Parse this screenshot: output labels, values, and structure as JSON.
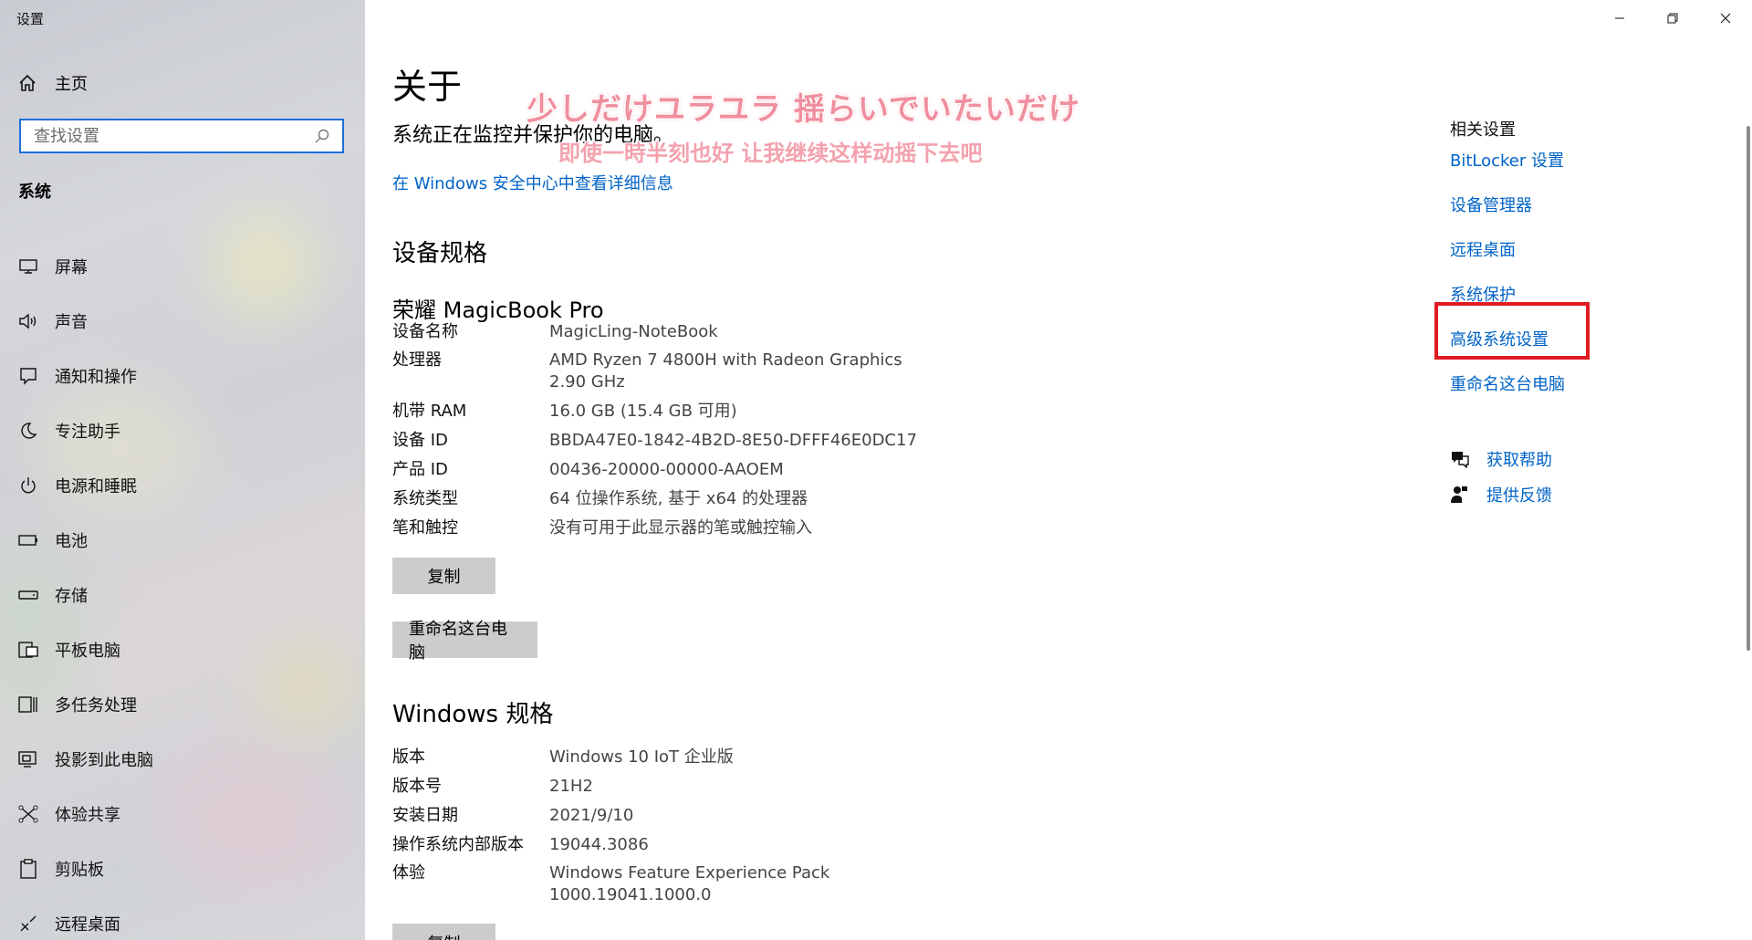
{
  "window": {
    "title": "设置",
    "controls": [
      "minimize-icon",
      "restore-icon",
      "close-icon"
    ]
  },
  "sidebar": {
    "home_label": "主页",
    "search_placeholder": "查找设置",
    "section_title": "系统",
    "items": [
      {
        "label": "屏幕",
        "icon": "monitor-icon"
      },
      {
        "label": "声音",
        "icon": "speaker-icon"
      },
      {
        "label": "通知和操作",
        "icon": "notification-icon"
      },
      {
        "label": "专注助手",
        "icon": "moon-icon"
      },
      {
        "label": "电源和睡眠",
        "icon": "power-icon"
      },
      {
        "label": "电池",
        "icon": "battery-icon"
      },
      {
        "label": "存储",
        "icon": "storage-icon"
      },
      {
        "label": "平板电脑",
        "icon": "tablet-icon"
      },
      {
        "label": "多任务处理",
        "icon": "multitask-icon"
      },
      {
        "label": "投影到此电脑",
        "icon": "project-icon"
      },
      {
        "label": "体验共享",
        "icon": "share-icon"
      },
      {
        "label": "剪贴板",
        "icon": "clipboard-icon"
      },
      {
        "label": "远程桌面",
        "icon": "remote-desktop-icon"
      }
    ]
  },
  "main": {
    "title": "关于",
    "protect_text": "系统正在监控并保护你的电脑。",
    "security_link": "在 Windows 安全中心中查看详细信息",
    "device_spec_title": "设备规格",
    "device_model": "荣耀 MagicBook Pro",
    "device_specs": [
      {
        "key": "设备名称",
        "value": "MagicLing-NoteBook"
      },
      {
        "key": "处理器",
        "value": "AMD Ryzen 7 4800H with Radeon Graphics",
        "value2": "2.90 GHz"
      },
      {
        "key": "机带 RAM",
        "value": "16.0 GB (15.4 GB 可用)"
      },
      {
        "key": "设备 ID",
        "value": "BBDA47E0-1842-4B2D-8E50-DFFF46E0DC17"
      },
      {
        "key": "产品 ID",
        "value": "00436-20000-00000-AAOEM"
      },
      {
        "key": "系统类型",
        "value": "64 位操作系统, 基于 x64 的处理器"
      },
      {
        "key": "笔和触控",
        "value": "没有可用于此显示器的笔或触控输入"
      }
    ],
    "copy_button": "复制",
    "rename_button": "重命名这台电脑",
    "windows_spec_title": "Windows 规格",
    "windows_specs": [
      {
        "key": "版本",
        "value": "Windows 10 IoT 企业版"
      },
      {
        "key": "版本号",
        "value": "21H2"
      },
      {
        "key": "安装日期",
        "value": "2021/9/10"
      },
      {
        "key": "操作系统内部版本",
        "value": "19044.3086"
      },
      {
        "key": "体验",
        "value": "Windows Feature Experience Pack",
        "value2": "1000.19041.1000.0"
      }
    ],
    "copy_button_2": "复制"
  },
  "overlay": {
    "lyric_line1": "少しだけユラユラ 揺らいでいたいだけ",
    "lyric_line2": "即使一時半刻也好 让我继续这样动摇下去吧"
  },
  "related": {
    "title": "相关设置",
    "links": [
      "BitLocker 设置",
      "设备管理器",
      "远程桌面",
      "系统保护",
      "高级系统设置",
      "重命名这台电脑"
    ],
    "highlighted": "高级系统设置",
    "get_help": "获取帮助",
    "feedback": "提供反馈"
  },
  "colors": {
    "link": "#0063c7",
    "highlight_border": "#e01a22",
    "search_border": "#1e6fd9",
    "button_bg": "#cccccc"
  }
}
